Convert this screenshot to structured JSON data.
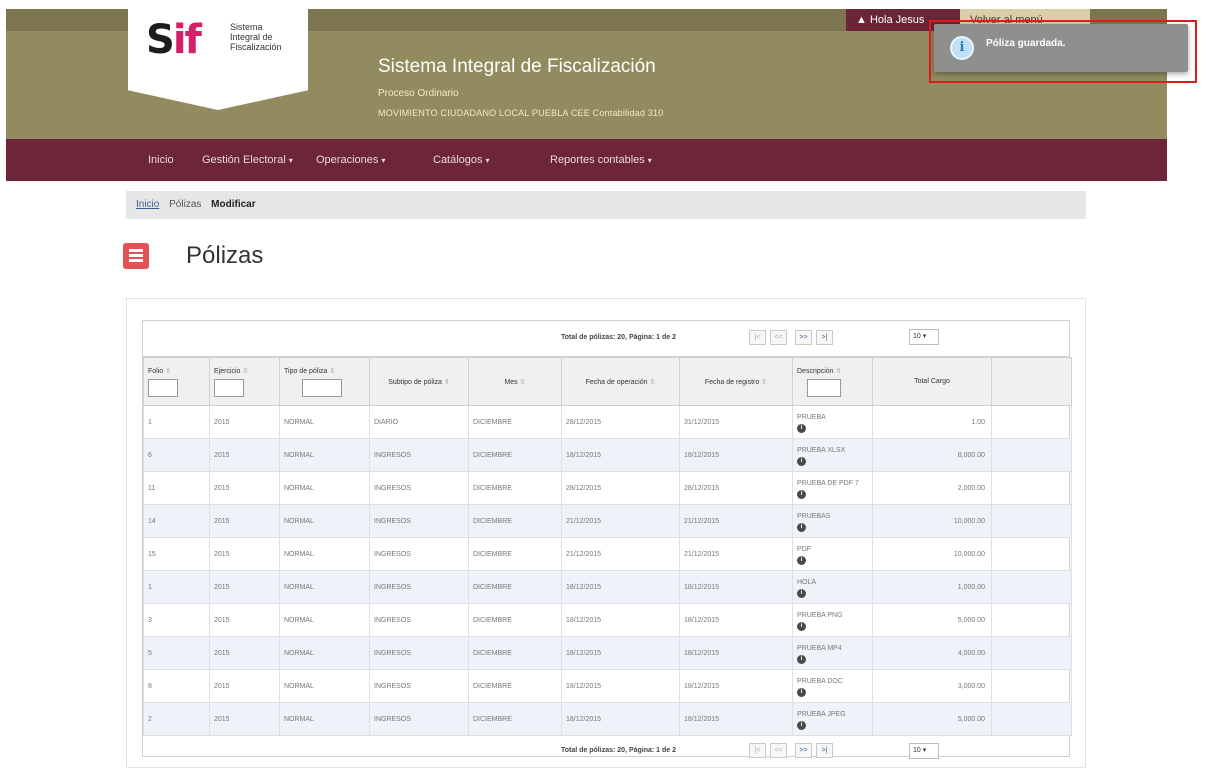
{
  "header": {
    "logo_mark_s": "S",
    "logo_mark_if": "if",
    "logo_line1": "Sistema",
    "logo_line2": "Integral de",
    "logo_line3": "Fiscalización",
    "title": "Sistema Integral de Fiscalización",
    "process": "Proceso Ordinario",
    "subject": "MOVIMIENTO CIUDADANO LOCAL PUEBLA CEE Contabilidad 310",
    "user_label": "Hola Jesus",
    "menu_label": "Volver al menú"
  },
  "nav": {
    "items": [
      {
        "label": "Inicio",
        "caret": ""
      },
      {
        "label": "Gestión Electoral",
        "caret": "▾"
      },
      {
        "label": "Operaciones",
        "caret": "▾"
      },
      {
        "label": "Catálogos",
        "caret": "▾"
      },
      {
        "label": "Reportes contables",
        "caret": "▾"
      }
    ]
  },
  "breadcrumb": [
    "Inicio",
    "Pólizas",
    "Modificar"
  ],
  "page": {
    "title": "Pólizas",
    "icon": "list-icon"
  },
  "toast": {
    "message": "Póliza guardada.",
    "icon": "info-icon"
  },
  "pager": {
    "summary": "Total de pólizas: 20, Página: 1 de 2",
    "first": "|<",
    "prev": "<<",
    "next": ">>",
    "last": ">|",
    "page_size": "10 ▾"
  },
  "table": {
    "columns": [
      {
        "label": "Folio",
        "filter": true
      },
      {
        "label": "Ejercicio",
        "filter": true
      },
      {
        "label": "Tipo de póliza",
        "filter": true
      },
      {
        "label": "Subtipo de póliza",
        "filter": false
      },
      {
        "label": "Mes",
        "filter": false
      },
      {
        "label": "Fecha de operación",
        "filter": false
      },
      {
        "label": "Fecha de registro",
        "filter": false
      },
      {
        "label": "Descripción",
        "filter": true
      },
      {
        "label": "Total Cargo",
        "filter": false
      }
    ],
    "rows": [
      [
        "1",
        "2015",
        "NORMAL",
        "DIARIO",
        "DICIEMBRE",
        "28/12/2015",
        "31/12/2015",
        "PRUEBA",
        "1.00"
      ],
      [
        "6",
        "2015",
        "NORMAL",
        "INGRESOS",
        "DICIEMBRE",
        "18/12/2015",
        "18/12/2015",
        "PRUEBA XLSX",
        "8,000.00"
      ],
      [
        "11",
        "2015",
        "NORMAL",
        "INGRESOS",
        "DICIEMBRE",
        "28/12/2015",
        "28/12/2015",
        "PRUEBA DE PDF 7",
        "2,000.00"
      ],
      [
        "14",
        "2015",
        "NORMAL",
        "INGRESOS",
        "DICIEMBRE",
        "21/12/2015",
        "21/12/2015",
        "PRUEBAS",
        "10,000.00"
      ],
      [
        "15",
        "2015",
        "NORMAL",
        "INGRESOS",
        "DICIEMBRE",
        "21/12/2015",
        "21/12/2015",
        "PDF",
        "10,000.00"
      ],
      [
        "1",
        "2015",
        "NORMAL",
        "INGRESOS",
        "DICIEMBRE",
        "18/12/2015",
        "18/12/2015",
        "HOLA",
        "1,000.00"
      ],
      [
        "3",
        "2015",
        "NORMAL",
        "INGRESOS",
        "DICIEMBRE",
        "18/12/2015",
        "18/12/2015",
        "PRUEBA PNG",
        "5,000.00"
      ],
      [
        "5",
        "2015",
        "NORMAL",
        "INGRESOS",
        "DICIEMBRE",
        "18/12/2015",
        "18/12/2015",
        "PRUEBA MP4",
        "4,000.00"
      ],
      [
        "8",
        "2015",
        "NORMAL",
        "INGRESOS",
        "DICIEMBRE",
        "18/12/2015",
        "18/12/2015",
        "PRUEBA DOC",
        "3,000.00"
      ],
      [
        "2",
        "2015",
        "NORMAL",
        "INGRESOS",
        "DICIEMBRE",
        "18/12/2015",
        "18/12/2015",
        "PRUEBA JPEG",
        "5,000.00"
      ]
    ],
    "sort_glyph": "⇳",
    "info_glyph": "i"
  }
}
